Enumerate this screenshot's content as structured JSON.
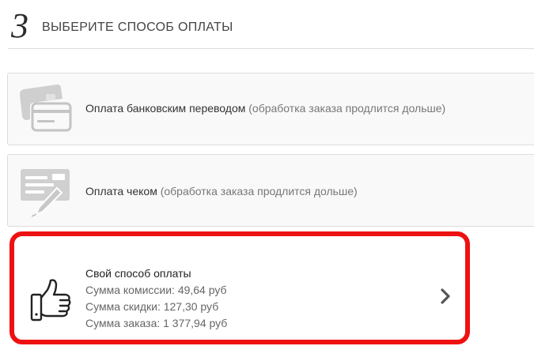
{
  "step": {
    "number": "3",
    "title": "ВЫБЕРИТЕ СПОСОБ ОПЛАТЫ"
  },
  "payment_options": [
    {
      "name": "Оплата банковским переводом",
      "note": "(обработка заказа продлится дольше)",
      "icon": "bank-card-icon"
    },
    {
      "name": "Оплата чеком",
      "note": "(обработка заказа продлится дольше)",
      "icon": "check-pen-icon"
    },
    {
      "name": "Свой способ оплаты",
      "fee": "Сумма комиссии: 49,64 руб",
      "discount": "Сумма скидки: 127,30 руб",
      "total": "Сумма заказа: 1 377,94 руб",
      "icon": "thumbs-up-icon",
      "selected": true
    }
  ],
  "colors": {
    "highlight": "#ee1111",
    "icon_gray": "#cccccc"
  }
}
